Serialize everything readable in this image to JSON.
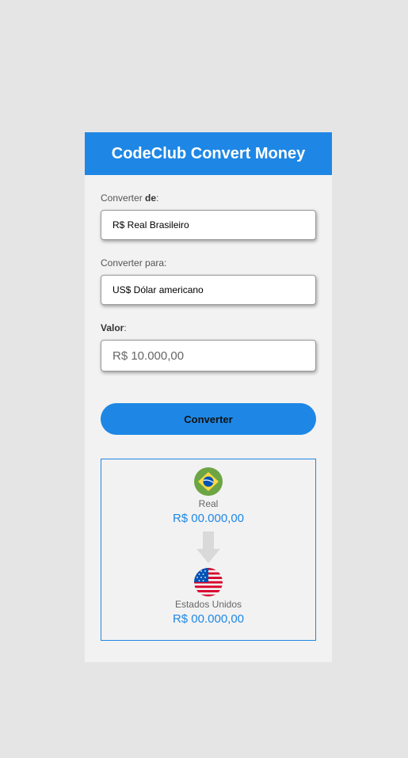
{
  "header": {
    "title": "CodeClub Convert Money"
  },
  "form": {
    "from_label_prefix": "Converter ",
    "from_label_bold": "de",
    "from_label_suffix": ":",
    "from_selected": "R$ Real Brasileiro",
    "to_label": "Converter para:",
    "to_selected": "US$ Dólar americano",
    "value_label_bold": "Valor",
    "value_label_suffix": ":",
    "value_placeholder": "R$ 10.000,00",
    "convert_label": "Converter"
  },
  "result": {
    "from": {
      "name": "Real",
      "value": "R$ 00.000,00",
      "flag": "brazil-flag-icon"
    },
    "to": {
      "name": "Estados Unidos",
      "value": "R$ 00.000,00",
      "flag": "usa-flag-icon"
    },
    "arrow_icon": "arrow-down-icon"
  },
  "colors": {
    "accent": "#1e87e5",
    "panel": "#f2f2f2",
    "background": "#e5e5e5"
  }
}
